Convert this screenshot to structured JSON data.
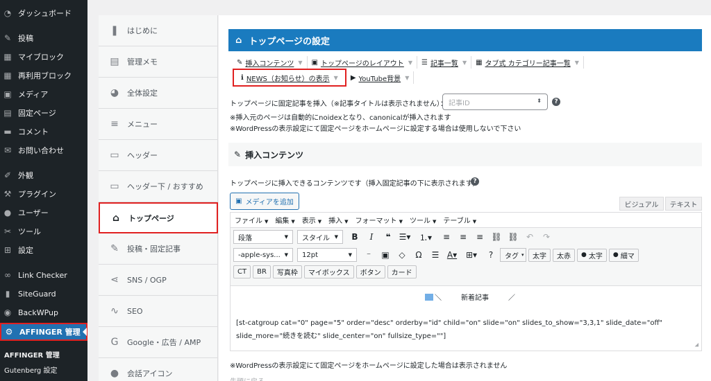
{
  "admin_menu": {
    "items": [
      {
        "label": "ダッシュボード",
        "icon": "dashboard-icon",
        "glyph": "◔"
      },
      {
        "label": "投稿",
        "icon": "pin-icon",
        "glyph": "✎"
      },
      {
        "label": "マイブロック",
        "icon": "blocks-icon",
        "glyph": "▦"
      },
      {
        "label": "再利用ブロック",
        "icon": "blocks-icon",
        "glyph": "▦"
      },
      {
        "label": "メディア",
        "icon": "media-icon",
        "glyph": "▣"
      },
      {
        "label": "固定ページ",
        "icon": "page-icon",
        "glyph": "▤"
      },
      {
        "label": "コメント",
        "icon": "comment-icon",
        "glyph": "▬"
      },
      {
        "label": "お問い合わせ",
        "icon": "mail-icon",
        "glyph": "✉"
      },
      {
        "label": "外観",
        "icon": "brush-icon",
        "glyph": "✐"
      },
      {
        "label": "プラグイン",
        "icon": "plugin-icon",
        "glyph": "⚒"
      },
      {
        "label": "ユーザー",
        "icon": "user-icon",
        "glyph": "●"
      },
      {
        "label": "ツール",
        "icon": "wrench-icon",
        "glyph": "✂"
      },
      {
        "label": "設定",
        "icon": "settings-icon",
        "glyph": "⊞"
      },
      {
        "label": "Link Checker",
        "icon": "link-checker-icon",
        "glyph": "∞"
      },
      {
        "label": "SiteGuard",
        "icon": "siteguard-icon",
        "glyph": "▮"
      },
      {
        "label": "BackWPup",
        "icon": "backwpup-icon",
        "glyph": "◉"
      },
      {
        "label": "AFFINGER 管理",
        "icon": "gear-icon",
        "glyph": "⚙"
      }
    ],
    "sub_items": [
      "AFFINGER 管理",
      "Gutenberg 設定"
    ]
  },
  "plugin_menu": {
    "items": [
      {
        "label": "はじめに",
        "icon": "beginner-icon",
        "glyph": "❚"
      },
      {
        "label": "管理メモ",
        "icon": "memo-icon",
        "glyph": "▤"
      },
      {
        "label": "全体設定",
        "icon": "palette-icon",
        "glyph": "◕"
      },
      {
        "label": "メニュー",
        "icon": "menu-lines-icon",
        "glyph": "≡"
      },
      {
        "label": "ヘッダー",
        "icon": "header-icon",
        "glyph": "▭"
      },
      {
        "label": "ヘッダー下 / おすすめ",
        "icon": "header-below-icon",
        "glyph": "▭"
      },
      {
        "label": "トップページ",
        "icon": "home-icon",
        "glyph": "⌂"
      },
      {
        "label": "投稿・固定記事",
        "icon": "edit-icon",
        "glyph": "✎"
      },
      {
        "label": "SNS / OGP",
        "icon": "share-icon",
        "glyph": "⋖"
      },
      {
        "label": "SEO",
        "icon": "chart-line-icon",
        "glyph": "∿"
      },
      {
        "label": "Google・広告 / AMP",
        "icon": "google-icon",
        "glyph": "G"
      },
      {
        "label": "会話アイコン",
        "icon": "chat-icon",
        "glyph": "●"
      }
    ]
  },
  "main": {
    "title": "トップページの設定",
    "tabs_row1": [
      {
        "label": "挿入コンテンツ",
        "glyph": "✎"
      },
      {
        "label": "トップページのレイアウト",
        "glyph": "▣"
      },
      {
        "label": "記事一覧",
        "glyph": "☰"
      },
      {
        "label": "タブ式 カテゴリー記事一覧",
        "glyph": "▦"
      }
    ],
    "tabs_row2": [
      {
        "label": "NEWS（お知らせ）の表示",
        "glyph": "ℹ"
      },
      {
        "label": "YouTube背景",
        "glyph": "▶"
      }
    ],
    "fixed_post_label": "トップページに固定記事を挿入（※記事タイトルは表示されません）：",
    "post_id_placeholder": "記事ID",
    "note1": "※挿入元のページは自動的にnoidexとなり、canonicalが挿入されます",
    "note2": "※WordPressの表示設定にて固定ページをホームページに設定する場合は使用しないで下さい",
    "section_title": "挿入コンテンツ",
    "section_desc": "トップページに挿入できるコンテンツです（挿入固定記事の下に表示されます）",
    "media_button": "メディアを追加",
    "visual_tab": "ビジュアル",
    "text_tab": "テキスト",
    "menubar": [
      "ファイル",
      "編集",
      "表示",
      "挿入",
      "フォーマット",
      "ツール",
      "テーブル"
    ],
    "format_select": "段落",
    "style_select": "スタイル",
    "font_select": "-apple-sys...",
    "size_select": "12pt",
    "tag_select": "タグ",
    "row2_buttons": [
      "太字",
      "太赤",
      "太字",
      "細マ"
    ],
    "row3_buttons": [
      "CT",
      "BR",
      "写真枠",
      "マイボックス",
      "ボタン",
      "カード"
    ],
    "news_text": "新着記事",
    "news_slash": "／",
    "shortcode": "[st-catgroup cat=\"0\" page=\"5\" order=\"desc\" orderby=\"id\" child=\"on\" slide=\"on\" slides_to_show=\"3,3,1\" slide_date=\"off\" slide_more=\"続きを読む\" slide_center=\"on\" fullsize_type=\"\"]",
    "footer_note": "※WordPressの表示設定にて固定ページをホームページに設定した場合は表示されません",
    "cut_text": "先頭に戻る"
  }
}
